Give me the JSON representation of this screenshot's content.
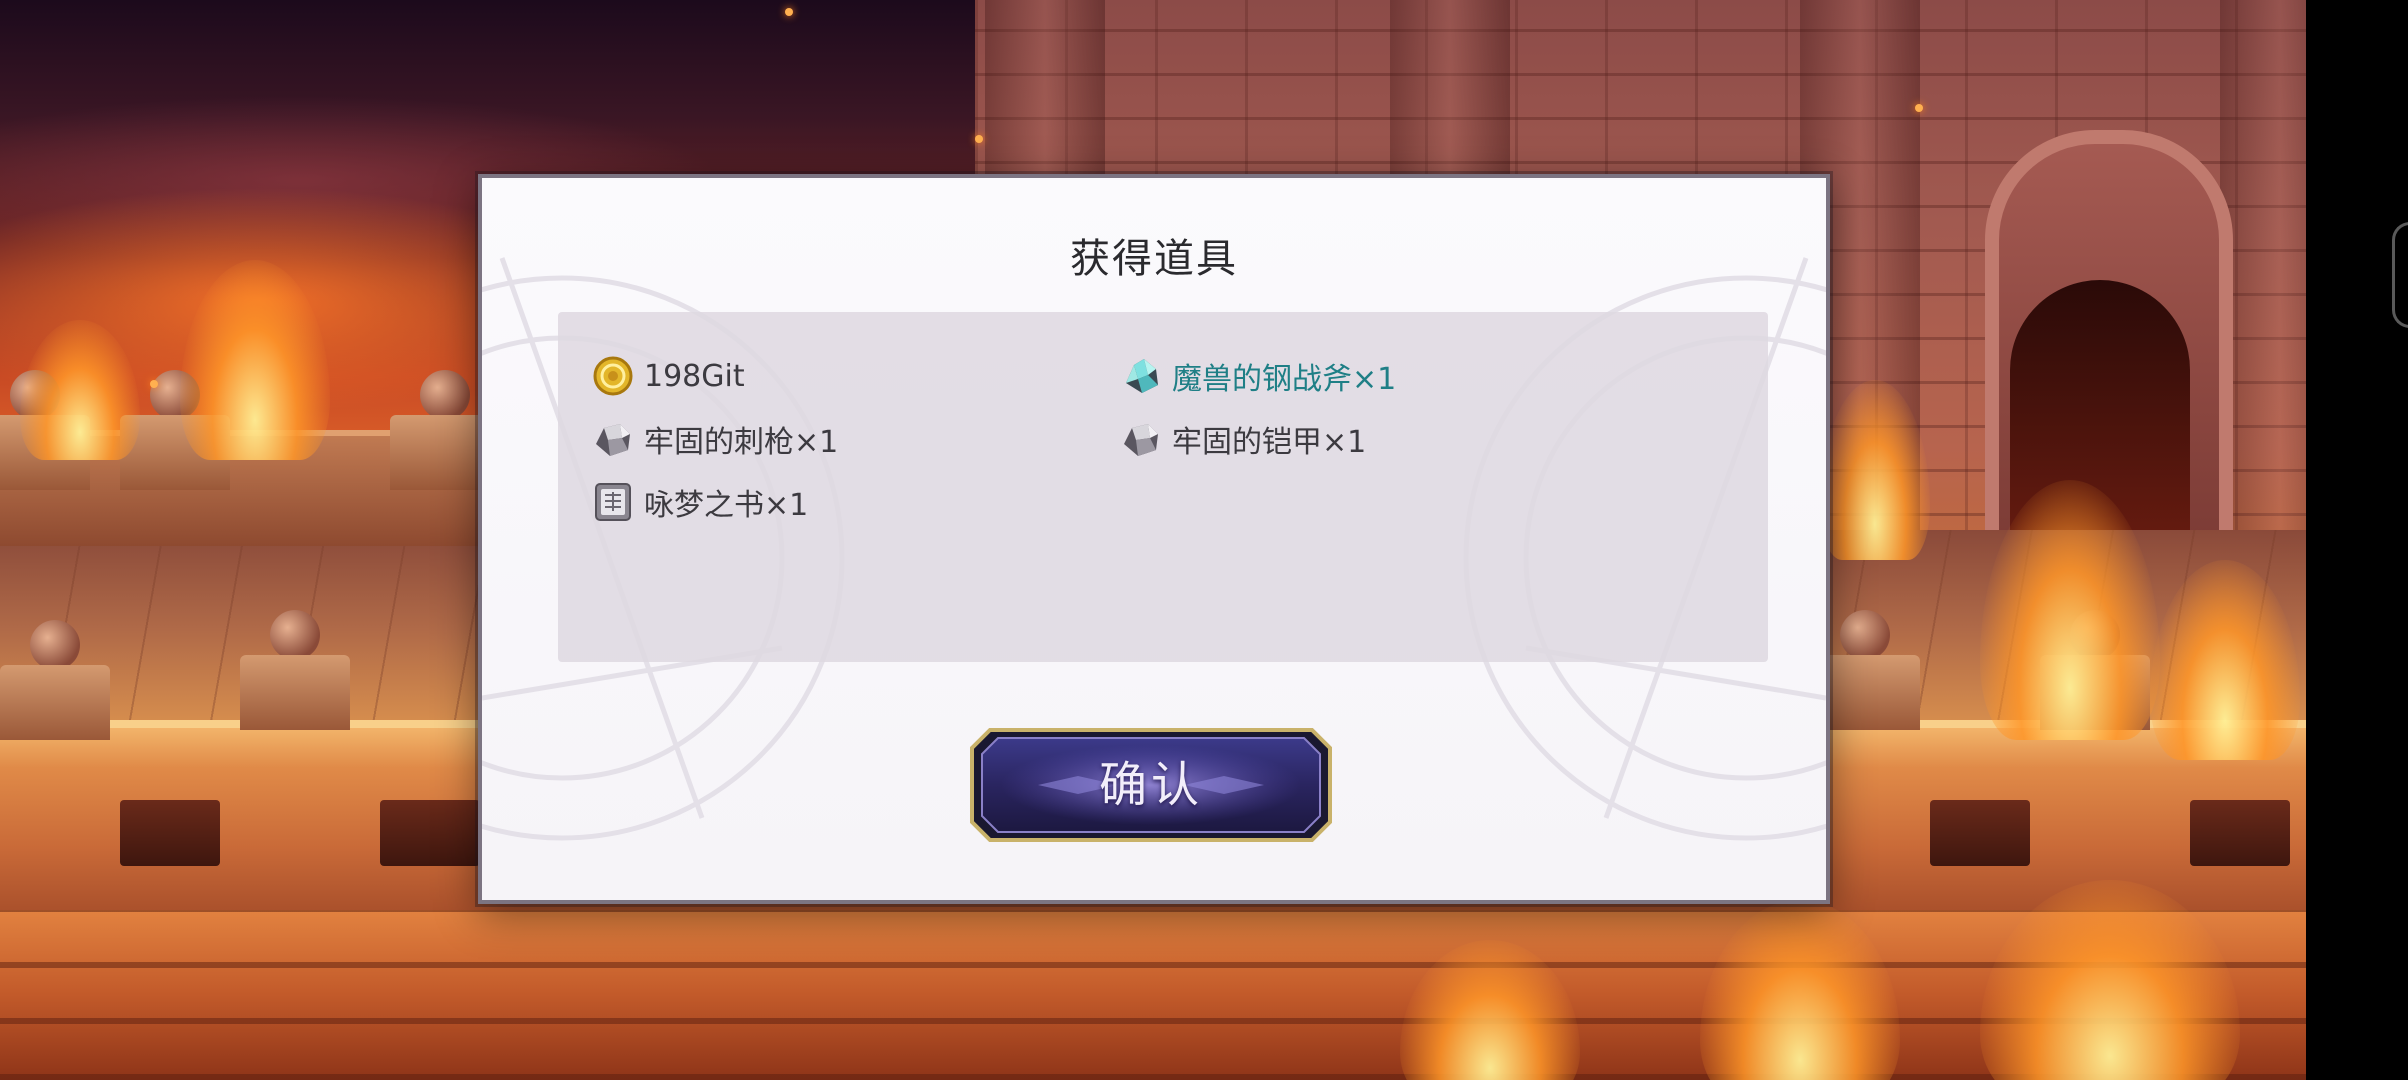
{
  "dialog": {
    "title": "获得道具",
    "confirm_label": "确认"
  },
  "items": [
    {
      "icon": "gold-coin-icon",
      "label": "198Git",
      "rare": false
    },
    {
      "icon": "crystal-ore-icon",
      "label": "魔兽的钢战斧×1",
      "rare": true
    },
    {
      "icon": "iron-ore-icon",
      "label": "牢固的刺枪×1",
      "rare": false
    },
    {
      "icon": "iron-ore-icon",
      "label": "牢固的铠甲×1",
      "rare": false
    },
    {
      "icon": "book-icon",
      "label": "咏梦之书×1",
      "rare": false
    }
  ],
  "colors": {
    "rare_item_text": "#1f7f86",
    "normal_item_text": "#3c3a40",
    "button_fill": "#2a2560",
    "button_border": "#c9b26a"
  }
}
